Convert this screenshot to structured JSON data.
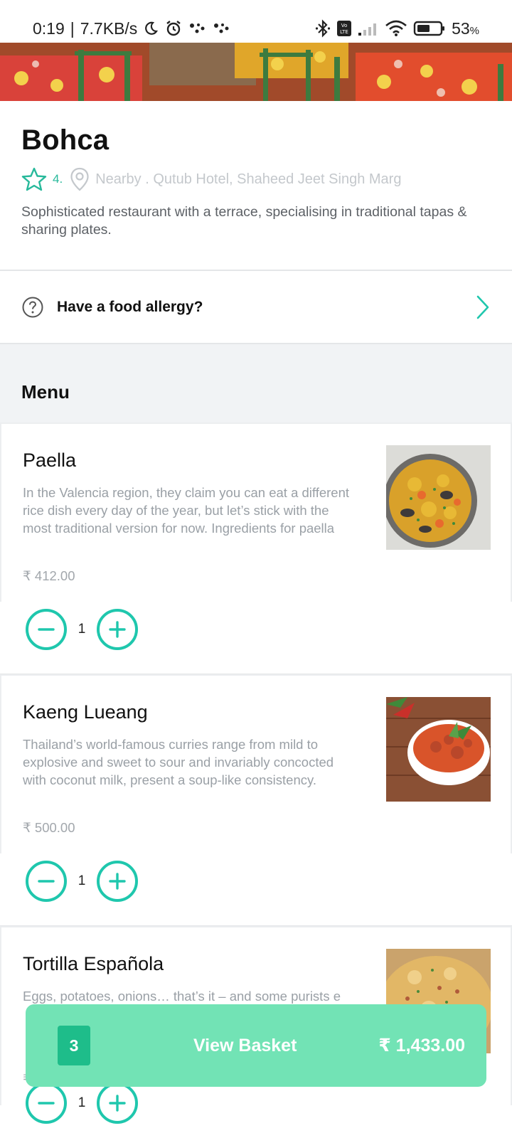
{
  "status_bar": {
    "time": "0:19",
    "network_speed": "7.7KB/s",
    "battery": "53",
    "battery_unit": "%",
    "icons": [
      "moon-icon",
      "alarm-icon",
      "notification-dots-icon",
      "bluetooth-icon",
      "volte-icon",
      "signal-icon",
      "wifi-icon",
      "battery-icon"
    ]
  },
  "restaurant": {
    "name": "Bohca",
    "rating": "4.",
    "location": "Nearby . Qutub Hotel, Shaheed Jeet Singh Marg",
    "description": "Sophisticated restaurant with a terrace, specialising in traditional tapas & sharing plates."
  },
  "allergy": {
    "label": "Have a food allergy?"
  },
  "menu": {
    "title": "Menu",
    "items": [
      {
        "name": "Paella",
        "description": "In the Valencia region, they claim you can eat a different rice dish every day of the year, but let’s stick with the most traditional version for now. Ingredients for paella",
        "price": "₹ 412.00",
        "quantity": "1"
      },
      {
        "name": "Kaeng Lueang",
        "description": "Thailand’s world-famous curries range from mild to explosive and sweet to sour and invariably concocted with coconut milk, present a soup-like consistency.",
        "price": "₹ 500.00",
        "quantity": "1"
      },
      {
        "name": "Tortilla Española",
        "description": "Eggs, potatoes, onions… that’s it – and some purists e",
        "price": "₹",
        "quantity": "1"
      }
    ]
  },
  "basket": {
    "count": "3",
    "label": "View Basket",
    "total": "₹ 1,433.00"
  },
  "colors": {
    "accent": "#1fc7ad",
    "basket_bg": "#72e3b5",
    "basket_count_bg": "#1ebd8a",
    "rating_green": "#28b99b"
  }
}
